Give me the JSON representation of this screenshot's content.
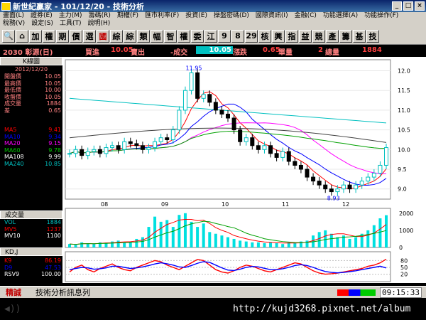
{
  "window": {
    "title": "新世紀贏家 - 101/12/20 - 技術分析"
  },
  "menu": [
    "畫面(L)",
    "證券(E)",
    "主力(M)",
    "籌碼(R)",
    "期權(F)",
    "匯市利率(F)",
    "投資(E)",
    "操盤密碼(D)",
    "國際資訊(I)",
    "金融(C)",
    "功能選擇(A)",
    "功能操作(F)",
    "稅務(V)",
    "設定(S)",
    "工具(T)",
    "說明(H)"
  ],
  "toolbar": [
    "加",
    "權",
    "期",
    "價",
    "選",
    "國",
    "綜",
    "綜",
    "類",
    "幅",
    "智",
    "權",
    "委",
    "江",
    "9",
    "8",
    "29",
    "核",
    "興",
    "指",
    "益",
    "競",
    "產",
    "籌",
    "基",
    "技"
  ],
  "quote": {
    "stock": "2030 彰源(日)",
    "buy_label": "買進",
    "buy": "10.05",
    "sell_label": "賣出",
    "change_label": "-成交",
    "last": "10.05",
    "change2_label": "漲跌",
    "change": "0.65",
    "unit_label": "單量",
    "vol1": "2",
    "vol_label": "總量",
    "volume": "1884"
  },
  "panel": {
    "header": "K線圖",
    "date": "2012/12/20",
    "price_rows": [
      [
        "開盤價",
        "10.05"
      ],
      [
        "最高價",
        "10.05"
      ],
      [
        "最低價",
        "10.00"
      ],
      [
        "收盤價",
        "10.05"
      ],
      [
        "成交量",
        "1884"
      ],
      [
        "差",
        "0.65"
      ]
    ],
    "ma_rows": [
      [
        "MA5",
        "9.41"
      ],
      [
        "MA10",
        "9.34"
      ],
      [
        "MA20",
        "9.15"
      ],
      [
        "MA60",
        "9.78"
      ],
      [
        "MA108",
        "9.99"
      ],
      [
        "MA240",
        "10.85"
      ]
    ],
    "vol_header": "成交量",
    "vol_rows": [
      [
        "VOL",
        "1884"
      ],
      [
        "MV5",
        "1237"
      ],
      [
        "MV10",
        "1100"
      ]
    ],
    "kd_header": "KD,J",
    "kd_rows": [
      [
        "K9",
        "86.19"
      ],
      [
        "D9",
        "47.53"
      ],
      [
        "RSV9",
        "100.00"
      ]
    ]
  },
  "chart_data": {
    "type": "line",
    "months": [
      "08",
      "09",
      "10",
      "11",
      "12"
    ],
    "high_label": "11.95",
    "low_label": "8.93",
    "price_ticks": [
      "12.0",
      "11.5",
      "11.0",
      "10.5",
      "10.0",
      "9.5",
      "9.0"
    ],
    "vol_ticks": [
      "2000",
      "1000",
      "0"
    ],
    "kd_ticks": [
      "80",
      "50",
      "20"
    ],
    "close": [
      9.9,
      10.0,
      9.85,
      9.95,
      10.0,
      9.9,
      10.05,
      10.1,
      10.0,
      10.2,
      10.15,
      10.1,
      10.0,
      10.05,
      10.2,
      10.3,
      10.25,
      10.5,
      11.0,
      11.5,
      11.95,
      11.3,
      11.4,
      11.2,
      11.0,
      10.9,
      10.8,
      10.5,
      10.2,
      10.3,
      10.1,
      10.0,
      10.1,
      9.9,
      9.8,
      9.95,
      9.7,
      9.6,
      9.5,
      9.3,
      9.2,
      9.1,
      9.0,
      8.93,
      9.0,
      9.1,
      9.0,
      9.1,
      9.2,
      9.3,
      9.4,
      9.6,
      10.05
    ],
    "volume": [
      200,
      150,
      300,
      250,
      200,
      300,
      280,
      350,
      400,
      300,
      350,
      500,
      600,
      1200,
      1800,
      1500,
      1600,
      1200,
      1900,
      2000,
      1500,
      1200,
      1400,
      900,
      800,
      700,
      600,
      500,
      400,
      350,
      300,
      300,
      250,
      300,
      250,
      200,
      300,
      250,
      350,
      400,
      700,
      900,
      1000,
      800,
      600,
      700,
      500,
      600,
      800,
      1000,
      1300,
      1700,
      1884
    ],
    "k": [
      30,
      50,
      60,
      40,
      30,
      45,
      55,
      65,
      50,
      40,
      35,
      50,
      60,
      70,
      80,
      75,
      60,
      50,
      40,
      55,
      70,
      85,
      80,
      60,
      40,
      30,
      25,
      35,
      50,
      60,
      55,
      45,
      35,
      30,
      40,
      50,
      60,
      70,
      65,
      50,
      35,
      25,
      20,
      22,
      25,
      30,
      35,
      40,
      45,
      55,
      60,
      70,
      86.19
    ],
    "d": [
      40,
      45,
      50,
      48,
      42,
      44,
      48,
      55,
      55,
      50,
      45,
      48,
      52,
      58,
      65,
      70,
      66,
      60,
      52,
      50,
      58,
      68,
      75,
      72,
      60,
      48,
      38,
      36,
      42,
      50,
      54,
      52,
      46,
      40,
      40,
      44,
      50,
      58,
      62,
      58,
      50,
      40,
      32,
      28,
      26,
      28,
      31,
      35,
      40,
      45,
      50,
      55,
      47.53
    ],
    "colors": {
      "ma5": "#ff0000",
      "ma10": "#0000ff",
      "ma20": "#ff00ff",
      "ma60": "#00a000",
      "ma108": "#404040",
      "ma240": "#00c0c0",
      "vol": "#00e0e0",
      "k": "#ff0000",
      "d": "#0000ff"
    }
  },
  "status": {
    "left": "精誠",
    "message": "技術分析訊息列",
    "time": "09:15:33"
  },
  "watermark": "http://kujd3268.pixnet.net/album"
}
